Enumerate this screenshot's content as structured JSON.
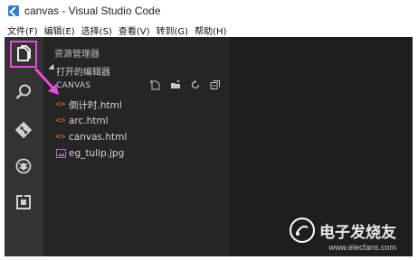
{
  "window": {
    "title": "canvas - Visual Studio Code"
  },
  "menu": [
    "文件(F)",
    "编辑(E)",
    "选择(S)",
    "查看(V)",
    "转到(G)",
    "帮助(H)"
  ],
  "activity_bar": [
    {
      "name": "explorer-icon"
    },
    {
      "name": "search-icon"
    },
    {
      "name": "git-icon"
    },
    {
      "name": "debug-icon"
    },
    {
      "name": "extensions-icon"
    }
  ],
  "sidebar": {
    "header": "资源管理器",
    "open_editors_label": "打开的编辑器",
    "folder_label": "CANVAS",
    "files": [
      {
        "label": "倒计时.html",
        "type": "html"
      },
      {
        "label": "arc.html",
        "type": "html"
      },
      {
        "label": "canvas.html",
        "type": "html"
      },
      {
        "label": "eg_tulip.jpg",
        "type": "jpg"
      }
    ]
  },
  "watermark": {
    "text": "电子发烧友",
    "sub": "www.elecfans.com"
  },
  "colors": {
    "highlight": "#e84be0",
    "activity_bg": "#333333",
    "sidebar_bg": "#252526",
    "editor_bg": "#1e1e1e",
    "html_icon": "#e37933",
    "image_icon": "#a074c4"
  }
}
